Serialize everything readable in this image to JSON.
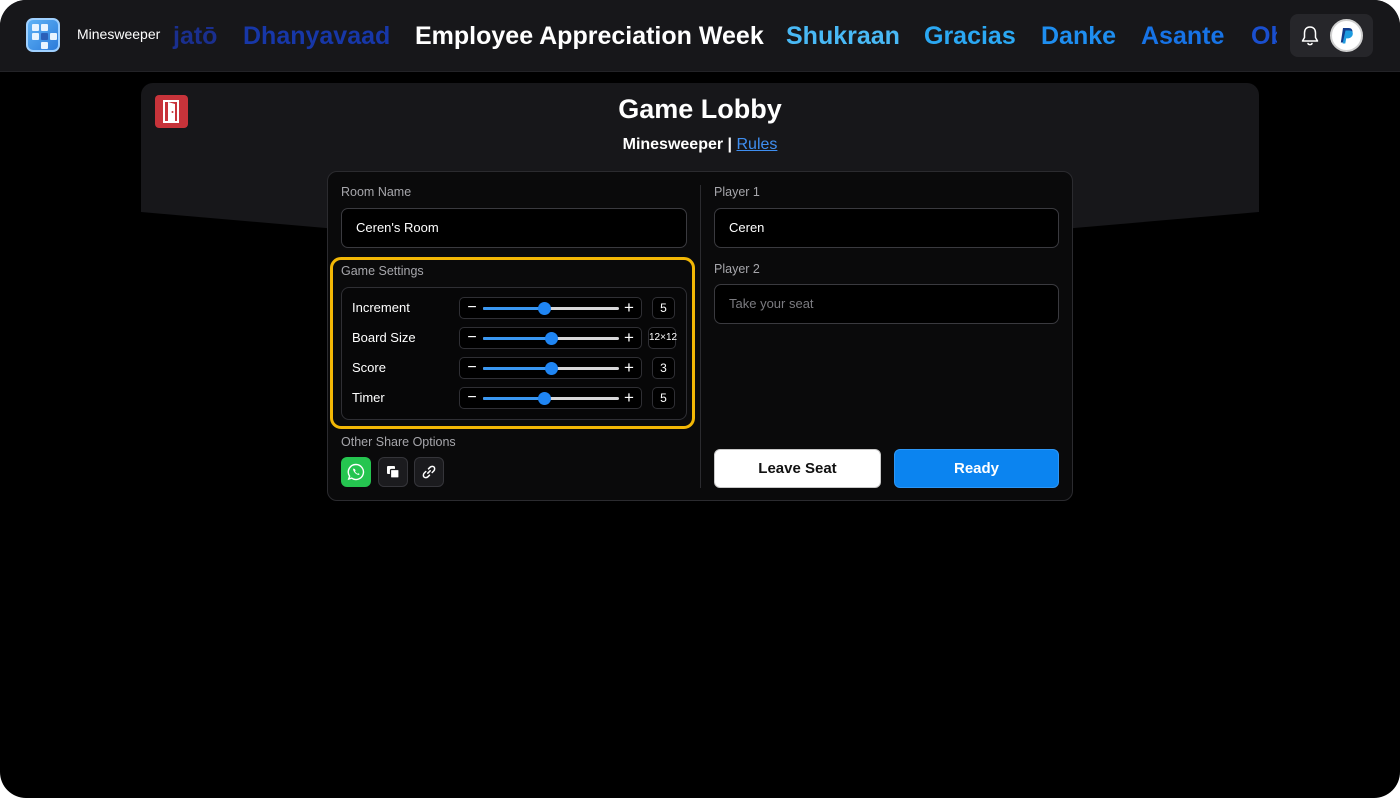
{
  "app": {
    "name": "Minesweeper"
  },
  "marquee": {
    "words": [
      {
        "text": "jatō",
        "color": "#1a2f8f"
      },
      {
        "text": "Dhanyavaad",
        "color": "#1737a8"
      },
      {
        "text": "Employee Appreciation Week",
        "color": "#ffffff"
      },
      {
        "text": "Shukraan",
        "color": "#49b9f5"
      },
      {
        "text": "Gracias",
        "color": "#2ba8f3"
      },
      {
        "text": "Danke",
        "color": "#1e8ef0"
      },
      {
        "text": "Asante",
        "color": "#1773e6"
      },
      {
        "text": "Ob",
        "color": "#1a4fcf"
      }
    ]
  },
  "header": {
    "notification_icon": "bell-icon",
    "avatar_icon": "paypal-p-logo"
  },
  "lobby": {
    "title": "Game Lobby",
    "game_name": "Minesweeper",
    "separator": "|",
    "rules_link": "Rules",
    "exit_icon": "door-exit-icon"
  },
  "room": {
    "label": "Room Name",
    "value": "Ceren's Room"
  },
  "settings": {
    "label": "Game Settings",
    "items": [
      {
        "label": "Increment",
        "value": "5",
        "level": 0.45
      },
      {
        "label": "Board Size",
        "value": "12×12",
        "level": 0.5
      },
      {
        "label": "Score",
        "value": "3",
        "level": 0.5
      },
      {
        "label": "Timer",
        "value": "5",
        "level": 0.45
      }
    ],
    "minus": "−",
    "plus": "+"
  },
  "share": {
    "label": "Other Share Options",
    "buttons": [
      "whatsapp-icon",
      "copy-icon",
      "link-icon"
    ]
  },
  "players": {
    "player1_label": "Player 1",
    "player1_value": "Ceren",
    "player2_label": "Player 2",
    "player2_placeholder": "Take your seat"
  },
  "actions": {
    "leave": "Leave Seat",
    "ready": "Ready"
  },
  "colors": {
    "accent": "#0b84f0",
    "highlight": "#f2b705",
    "exit": "#c7333a",
    "whatsapp": "#25c550"
  }
}
